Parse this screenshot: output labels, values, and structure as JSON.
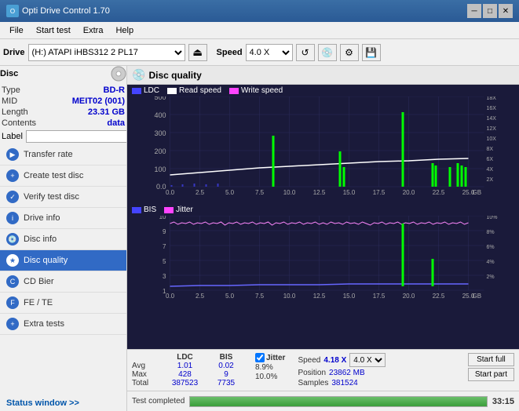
{
  "titlebar": {
    "title": "Opti Drive Control 1.70",
    "icon": "O",
    "min": "─",
    "max": "□",
    "close": "✕"
  },
  "menubar": {
    "items": [
      "File",
      "Start test",
      "Extra",
      "Help"
    ]
  },
  "drivebar": {
    "label": "Drive",
    "drive_value": "(H:) ATAPI iHBS312  2 PL17",
    "speed_label": "Speed",
    "speed_value": "4.0 X"
  },
  "disc": {
    "header": "Disc",
    "type_label": "Type",
    "type_val": "BD-R",
    "mid_label": "MID",
    "mid_val": "MEIT02 (001)",
    "length_label": "Length",
    "length_val": "23.31 GB",
    "contents_label": "Contents",
    "contents_val": "data",
    "label_label": "Label",
    "label_val": ""
  },
  "nav": {
    "items": [
      {
        "id": "transfer-rate",
        "label": "Transfer rate",
        "active": false
      },
      {
        "id": "create-test-disc",
        "label": "Create test disc",
        "active": false
      },
      {
        "id": "verify-test-disc",
        "label": "Verify test disc",
        "active": false
      },
      {
        "id": "drive-info",
        "label": "Drive info",
        "active": false
      },
      {
        "id": "disc-info",
        "label": "Disc info",
        "active": false
      },
      {
        "id": "disc-quality",
        "label": "Disc quality",
        "active": true
      },
      {
        "id": "cd-bier",
        "label": "CD Bier",
        "active": false
      },
      {
        "id": "fe-te",
        "label": "FE / TE",
        "active": false
      },
      {
        "id": "extra-tests",
        "label": "Extra tests",
        "active": false
      }
    ]
  },
  "status_window": "Status window >>",
  "disc_quality": {
    "title": "Disc quality",
    "legend": {
      "ldc_label": "LDC",
      "read_label": "Read speed",
      "write_label": "Write speed",
      "bis_label": "BIS",
      "jitter_label": "Jitter"
    }
  },
  "chart1": {
    "y_max": 500,
    "y_labels": [
      "500",
      "400",
      "300",
      "200",
      "100",
      "0.0"
    ],
    "x_labels": [
      "0.0",
      "2.5",
      "5.0",
      "7.5",
      "10.0",
      "12.5",
      "15.0",
      "17.5",
      "20.0",
      "22.5",
      "25.0"
    ],
    "right_labels": [
      "18X",
      "16X",
      "14X",
      "12X",
      "10X",
      "8X",
      "6X",
      "4X",
      "2X"
    ]
  },
  "chart2": {
    "y_max": 10,
    "y_labels": [
      "10",
      "9",
      "8",
      "7",
      "6",
      "5",
      "4",
      "3",
      "2",
      "1"
    ],
    "x_labels": [
      "0.0",
      "2.5",
      "5.0",
      "7.5",
      "10.0",
      "12.5",
      "15.0",
      "17.5",
      "20.0",
      "22.5",
      "25.0"
    ],
    "right_labels": [
      "10%",
      "8%",
      "6%",
      "4%",
      "2%"
    ]
  },
  "stats": {
    "headers": [
      "",
      "LDC",
      "BIS",
      "",
      "Jitter",
      "Speed",
      ""
    ],
    "avg_label": "Avg",
    "avg_ldc": "1.01",
    "avg_bis": "0.02",
    "avg_jitter": "8.9%",
    "avg_speed": "4.18 X",
    "avg_speed_select": "4.0 X",
    "max_label": "Max",
    "max_ldc": "428",
    "max_bis": "9",
    "max_jitter": "10.0%",
    "max_position": "23862 MB",
    "total_label": "Total",
    "total_ldc": "387523",
    "total_bis": "7735",
    "total_samples": "381524",
    "position_label": "Position",
    "samples_label": "Samples",
    "start_full": "Start full",
    "start_part": "Start part",
    "jitter_checked": true,
    "jitter_label": "Jitter"
  },
  "statusbar": {
    "text": "Test completed",
    "progress": 100,
    "time": "33:15"
  }
}
